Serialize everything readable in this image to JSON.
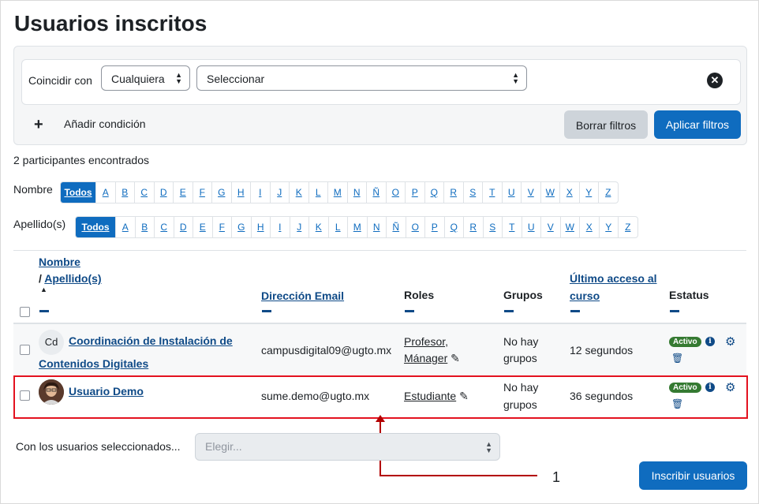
{
  "page": {
    "title": "Usuarios inscritos"
  },
  "filters": {
    "match_label": "Coincidir con",
    "match_value": "Cualquiera",
    "type_value": "Seleccionar",
    "add_condition": "Añadir condición",
    "clear_label": "Borrar filtros",
    "apply_label": "Aplicar filtros"
  },
  "summary": {
    "found": "2 participantes encontrados"
  },
  "initials": {
    "first_label": "Nombre",
    "last_label": "Apellido(s)",
    "all": "Todos",
    "letters": [
      "A",
      "B",
      "C",
      "D",
      "E",
      "F",
      "G",
      "H",
      "I",
      "J",
      "K",
      "L",
      "M",
      "N",
      "Ñ",
      "O",
      "P",
      "Q",
      "R",
      "S",
      "T",
      "U",
      "V",
      "W",
      "X",
      "Y",
      "Z"
    ]
  },
  "table": {
    "headers": {
      "first_name": "Nombre",
      "sep": "/ ",
      "last_name": "Apellido(s)",
      "email": "Dirección Email",
      "roles": "Roles",
      "groups": "Grupos",
      "last_access_1": "Último acceso al",
      "last_access_2": "curso",
      "status": "Estatus"
    },
    "rows": [
      {
        "initials": "Cd",
        "name_1": "Coordinación de Instalación de",
        "name_2": "Contenidos Digitales",
        "email": "campusdigital09@ugto.mx",
        "role_1": "Profesor,",
        "role_2": "Mánager",
        "groups_1": "No hay",
        "groups_2": "grupos",
        "last_access": "12 segundos",
        "status": "Activo"
      },
      {
        "name_1": "Usuario Demo",
        "email": "sume.demo@ugto.mx",
        "role_1": "Estudiante",
        "groups_1": "No hay",
        "groups_2": "grupos",
        "last_access": "36 segundos",
        "status": "Activo"
      }
    ]
  },
  "bulk": {
    "label": "Con los usuarios seleccionados...",
    "placeholder": "Elegir..."
  },
  "enrol_button": "Inscribir usuarios",
  "callout": {
    "number": "1"
  },
  "colors": {
    "primary": "#0f6cbf",
    "link": "#0f4a87",
    "active_badge": "#357a32",
    "highlight": "#e3121f"
  }
}
